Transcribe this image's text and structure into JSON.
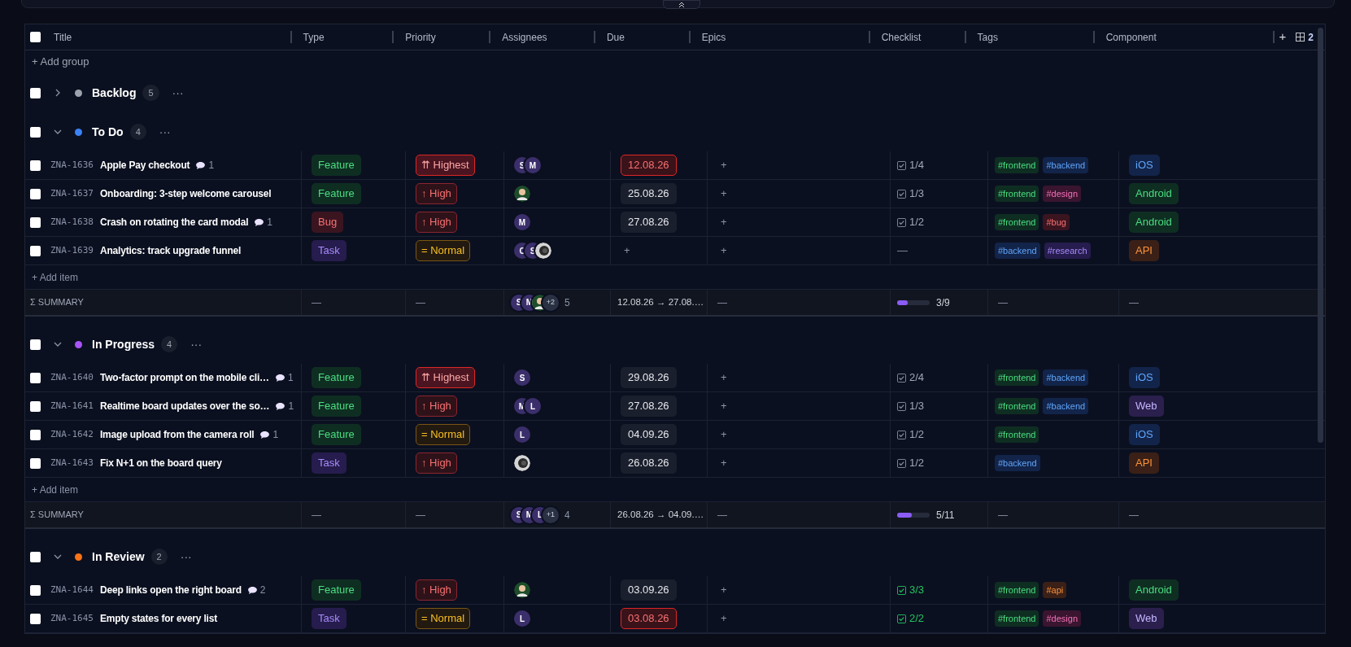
{
  "header": {
    "checked": false,
    "columns": [
      "Title",
      "Type",
      "Priority",
      "Assignees",
      "Due",
      "Epics",
      "Checklist",
      "Tags",
      "Component"
    ],
    "add_column": "+",
    "view_count": "2"
  },
  "add_group": "+ Add group",
  "groups": [
    {
      "name": "Backlog",
      "color": "#9ca3af",
      "count": "5",
      "expanded": false,
      "checked": false,
      "more": "···"
    },
    {
      "name": "To Do",
      "color": "#3b82f6",
      "count": "4",
      "expanded": true,
      "checked": false,
      "more": "···",
      "add_item": "+ Add item",
      "rows": [
        {
          "id": "ZNA-1636",
          "title": "Apple Pay checkout",
          "comments": "1",
          "checked": false,
          "type": {
            "text": "Feature",
            "kind": "green"
          },
          "priority": {
            "text": "⇈ Highest",
            "kind": "highest"
          },
          "assignees": [
            {
              "kind": "letter",
              "text": "S"
            },
            {
              "kind": "letter",
              "text": "M"
            }
          ],
          "due": {
            "kind": "date",
            "text": "12.08.26",
            "overdue": true
          },
          "epics": "+",
          "checklist": {
            "kind": "count",
            "text": "1/4",
            "done": false
          },
          "tags": [
            {
              "text": "#frontend",
              "kind": "green"
            },
            {
              "text": "#backend",
              "kind": "blue"
            }
          ],
          "component": {
            "text": "iOS",
            "kind": "blue"
          }
        },
        {
          "id": "ZNA-1637",
          "title": "Onboarding: 3-step welcome carousel",
          "checked": false,
          "type": {
            "text": "Feature",
            "kind": "green"
          },
          "priority": {
            "text": "↑ High",
            "kind": "high"
          },
          "assignees": [
            {
              "kind": "person"
            }
          ],
          "due": {
            "kind": "date",
            "text": "25.08.26",
            "overdue": false
          },
          "epics": "+",
          "checklist": {
            "kind": "count",
            "text": "1/3",
            "done": false
          },
          "tags": [
            {
              "text": "#frontend",
              "kind": "green"
            },
            {
              "text": "#design",
              "kind": "pink"
            }
          ],
          "component": {
            "text": "Android",
            "kind": "green"
          }
        },
        {
          "id": "ZNA-1638",
          "title": "Crash on rotating the card modal",
          "comments": "1",
          "checked": false,
          "type": {
            "text": "Bug",
            "kind": "red"
          },
          "priority": {
            "text": "↑ High",
            "kind": "high"
          },
          "assignees": [
            {
              "kind": "letter",
              "text": "M"
            }
          ],
          "due": {
            "kind": "date",
            "text": "27.08.26",
            "overdue": false
          },
          "epics": "+",
          "checklist": {
            "kind": "count",
            "text": "1/2",
            "done": false
          },
          "tags": [
            {
              "text": "#frontend",
              "kind": "green"
            },
            {
              "text": "#bug",
              "kind": "red"
            }
          ],
          "component": {
            "text": "Android",
            "kind": "green"
          }
        },
        {
          "id": "ZNA-1639",
          "title": "Analytics: track upgrade funnel",
          "checked": false,
          "type": {
            "text": "Task",
            "kind": "purple"
          },
          "priority": {
            "text": "= Normal",
            "kind": "normal"
          },
          "assignees": [
            {
              "kind": "letter",
              "text": "C"
            },
            {
              "kind": "letter",
              "text": "S"
            },
            {
              "kind": "sphere"
            }
          ],
          "due": {
            "kind": "add",
            "text": "+"
          },
          "epics": "+",
          "checklist": {
            "kind": "none",
            "text": "—"
          },
          "tags": [
            {
              "text": "#backend",
              "kind": "blue"
            },
            {
              "text": "#research",
              "kind": "purple"
            }
          ],
          "component": {
            "text": "API",
            "kind": "orange"
          }
        }
      ],
      "summary": {
        "label": "Σ SUMMARY",
        "type": "—",
        "priority": "—",
        "assignees": [
          {
            "kind": "letter",
            "text": "S"
          },
          {
            "kind": "letter",
            "text": "M"
          },
          {
            "kind": "person"
          },
          {
            "kind": "more",
            "text": "+2"
          }
        ],
        "assignee_count": "5",
        "due": "12.08.26 → 27.08.…",
        "epics": "—",
        "progress": {
          "level": 0.33,
          "text": "3/9"
        },
        "tags": "—",
        "component": "—"
      }
    },
    {
      "name": "In Progress",
      "color": "#a855f7",
      "count": "4",
      "expanded": true,
      "checked": false,
      "more": "···",
      "add_item": "+ Add item",
      "rows": [
        {
          "id": "ZNA-1640",
          "title": "Two-factor prompt on the mobile cli…",
          "comments": "1",
          "checked": false,
          "type": {
            "text": "Feature",
            "kind": "green"
          },
          "priority": {
            "text": "⇈ Highest",
            "kind": "highest"
          },
          "assignees": [
            {
              "kind": "letter",
              "text": "S"
            }
          ],
          "due": {
            "kind": "date",
            "text": "29.08.26",
            "overdue": false
          },
          "epics": "+",
          "checklist": {
            "kind": "count",
            "text": "2/4",
            "done": false
          },
          "tags": [
            {
              "text": "#frontend",
              "kind": "green"
            },
            {
              "text": "#backend",
              "kind": "blue"
            }
          ],
          "component": {
            "text": "iOS",
            "kind": "blue"
          }
        },
        {
          "id": "ZNA-1641",
          "title": "Realtime board updates over the so…",
          "comments": "1",
          "checked": false,
          "type": {
            "text": "Feature",
            "kind": "green"
          },
          "priority": {
            "text": "↑ High",
            "kind": "high"
          },
          "assignees": [
            {
              "kind": "letter",
              "text": "M"
            },
            {
              "kind": "letter",
              "text": "L"
            }
          ],
          "due": {
            "kind": "date",
            "text": "27.08.26",
            "overdue": false
          },
          "epics": "+",
          "checklist": {
            "kind": "count",
            "text": "1/3",
            "done": false
          },
          "tags": [
            {
              "text": "#frontend",
              "kind": "green"
            },
            {
              "text": "#backend",
              "kind": "blue"
            }
          ],
          "component": {
            "text": "Web",
            "kind": "violet"
          }
        },
        {
          "id": "ZNA-1642",
          "title": "Image upload from the camera roll",
          "comments": "1",
          "checked": false,
          "type": {
            "text": "Feature",
            "kind": "green"
          },
          "priority": {
            "text": "= Normal",
            "kind": "normal"
          },
          "assignees": [
            {
              "kind": "letter",
              "text": "L"
            }
          ],
          "due": {
            "kind": "date",
            "text": "04.09.26",
            "overdue": false
          },
          "epics": "+",
          "checklist": {
            "kind": "count",
            "text": "1/2",
            "done": false
          },
          "tags": [
            {
              "text": "#frontend",
              "kind": "green"
            }
          ],
          "component": {
            "text": "iOS",
            "kind": "blue"
          }
        },
        {
          "id": "ZNA-1643",
          "title": "Fix N+1 on the board query",
          "checked": false,
          "type": {
            "text": "Task",
            "kind": "purple"
          },
          "priority": {
            "text": "↑ High",
            "kind": "high"
          },
          "assignees": [
            {
              "kind": "sphere"
            }
          ],
          "due": {
            "kind": "date",
            "text": "26.08.26",
            "overdue": false
          },
          "epics": "+",
          "checklist": {
            "kind": "count",
            "text": "1/2",
            "done": false
          },
          "tags": [
            {
              "text": "#backend",
              "kind": "blue"
            }
          ],
          "component": {
            "text": "API",
            "kind": "orange"
          }
        }
      ],
      "summary": {
        "label": "Σ SUMMARY",
        "type": "—",
        "priority": "—",
        "assignees": [
          {
            "kind": "letter",
            "text": "S"
          },
          {
            "kind": "letter",
            "text": "M"
          },
          {
            "kind": "letter",
            "text": "L"
          },
          {
            "kind": "more",
            "text": "+1"
          }
        ],
        "assignee_count": "4",
        "due": "26.08.26 → 04.09.…",
        "epics": "—",
        "progress": {
          "level": 0.45,
          "text": "5/11"
        },
        "tags": "—",
        "component": "—"
      }
    },
    {
      "name": "In Review",
      "color": "#f97316",
      "count": "2",
      "expanded": true,
      "checked": false,
      "more": "···",
      "rows": [
        {
          "id": "ZNA-1644",
          "title": "Deep links open the right board",
          "comments": "2",
          "checked": false,
          "type": {
            "text": "Feature",
            "kind": "green"
          },
          "priority": {
            "text": "↑ High",
            "kind": "high"
          },
          "assignees": [
            {
              "kind": "person"
            }
          ],
          "due": {
            "kind": "date",
            "text": "03.09.26",
            "overdue": false
          },
          "epics": "+",
          "checklist": {
            "kind": "count",
            "text": "3/3",
            "done": true
          },
          "tags": [
            {
              "text": "#frontend",
              "kind": "green"
            },
            {
              "text": "#api",
              "kind": "orange"
            }
          ],
          "component": {
            "text": "Android",
            "kind": "green"
          }
        },
        {
          "id": "ZNA-1645",
          "title": "Empty states for every list",
          "checked": false,
          "type": {
            "text": "Task",
            "kind": "purple"
          },
          "priority": {
            "text": "= Normal",
            "kind": "normal"
          },
          "assignees": [
            {
              "kind": "letter",
              "text": "L"
            }
          ],
          "due": {
            "kind": "date",
            "text": "03.08.26",
            "overdue": true
          },
          "epics": "+",
          "checklist": {
            "kind": "count",
            "text": "2/2",
            "done": true
          },
          "tags": [
            {
              "text": "#frontend",
              "kind": "green"
            },
            {
              "text": "#design",
              "kind": "pink"
            }
          ],
          "component": {
            "text": "Web",
            "kind": "violet"
          }
        }
      ]
    }
  ]
}
